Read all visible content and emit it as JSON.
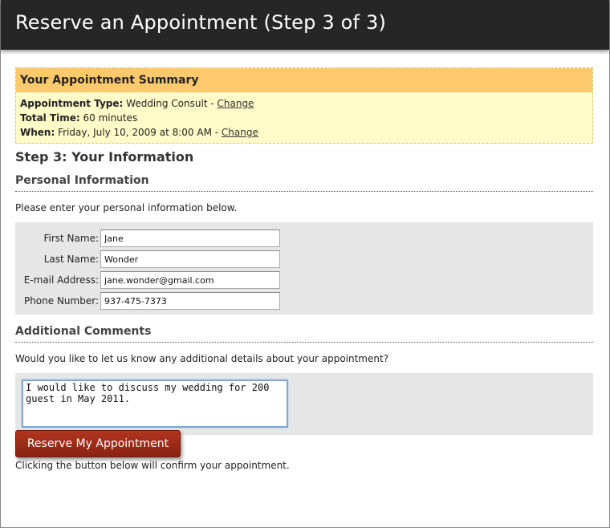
{
  "header": {
    "title": "Reserve an Appointment (Step 3 of 3)"
  },
  "summary": {
    "title": "Your Appointment Summary",
    "type_label": "Appointment Type:",
    "type_value": "Wedding Consult - ",
    "change_label": "Change",
    "time_label": "Total Time:",
    "time_value": "60 minutes",
    "when_label": "When:",
    "when_value": "Friday, July 10, 2009 at 8:00 AM - "
  },
  "step_title": "Step 3: Your Information",
  "personal": {
    "title": "Personal Information",
    "intro": "Please enter your personal information below.",
    "first_name_label": "First Name:",
    "first_name_value": "Jane",
    "last_name_label": "Last Name:",
    "last_name_value": "Wonder",
    "email_label": "E-mail Address:",
    "email_value": "jane.wonder@gmail.com",
    "phone_label": "Phone Number:",
    "phone_value": "937-475-7373"
  },
  "comments": {
    "title": "Additional Comments",
    "intro": "Would you like to let us know any additional details about your appointment?",
    "value": "I would like to discuss my wedding for 200 guest in May 2011."
  },
  "confirm_text": "Clicking the button below will confirm your appointment.",
  "submit_label": "Reserve My Appointment",
  "colors": {
    "header_bg": "#262626",
    "summary_title_bg": "#fcc96c",
    "summary_bg": "#fffbc8",
    "button_bg": "#9b2a17",
    "form_bg": "#e6e6e6"
  }
}
